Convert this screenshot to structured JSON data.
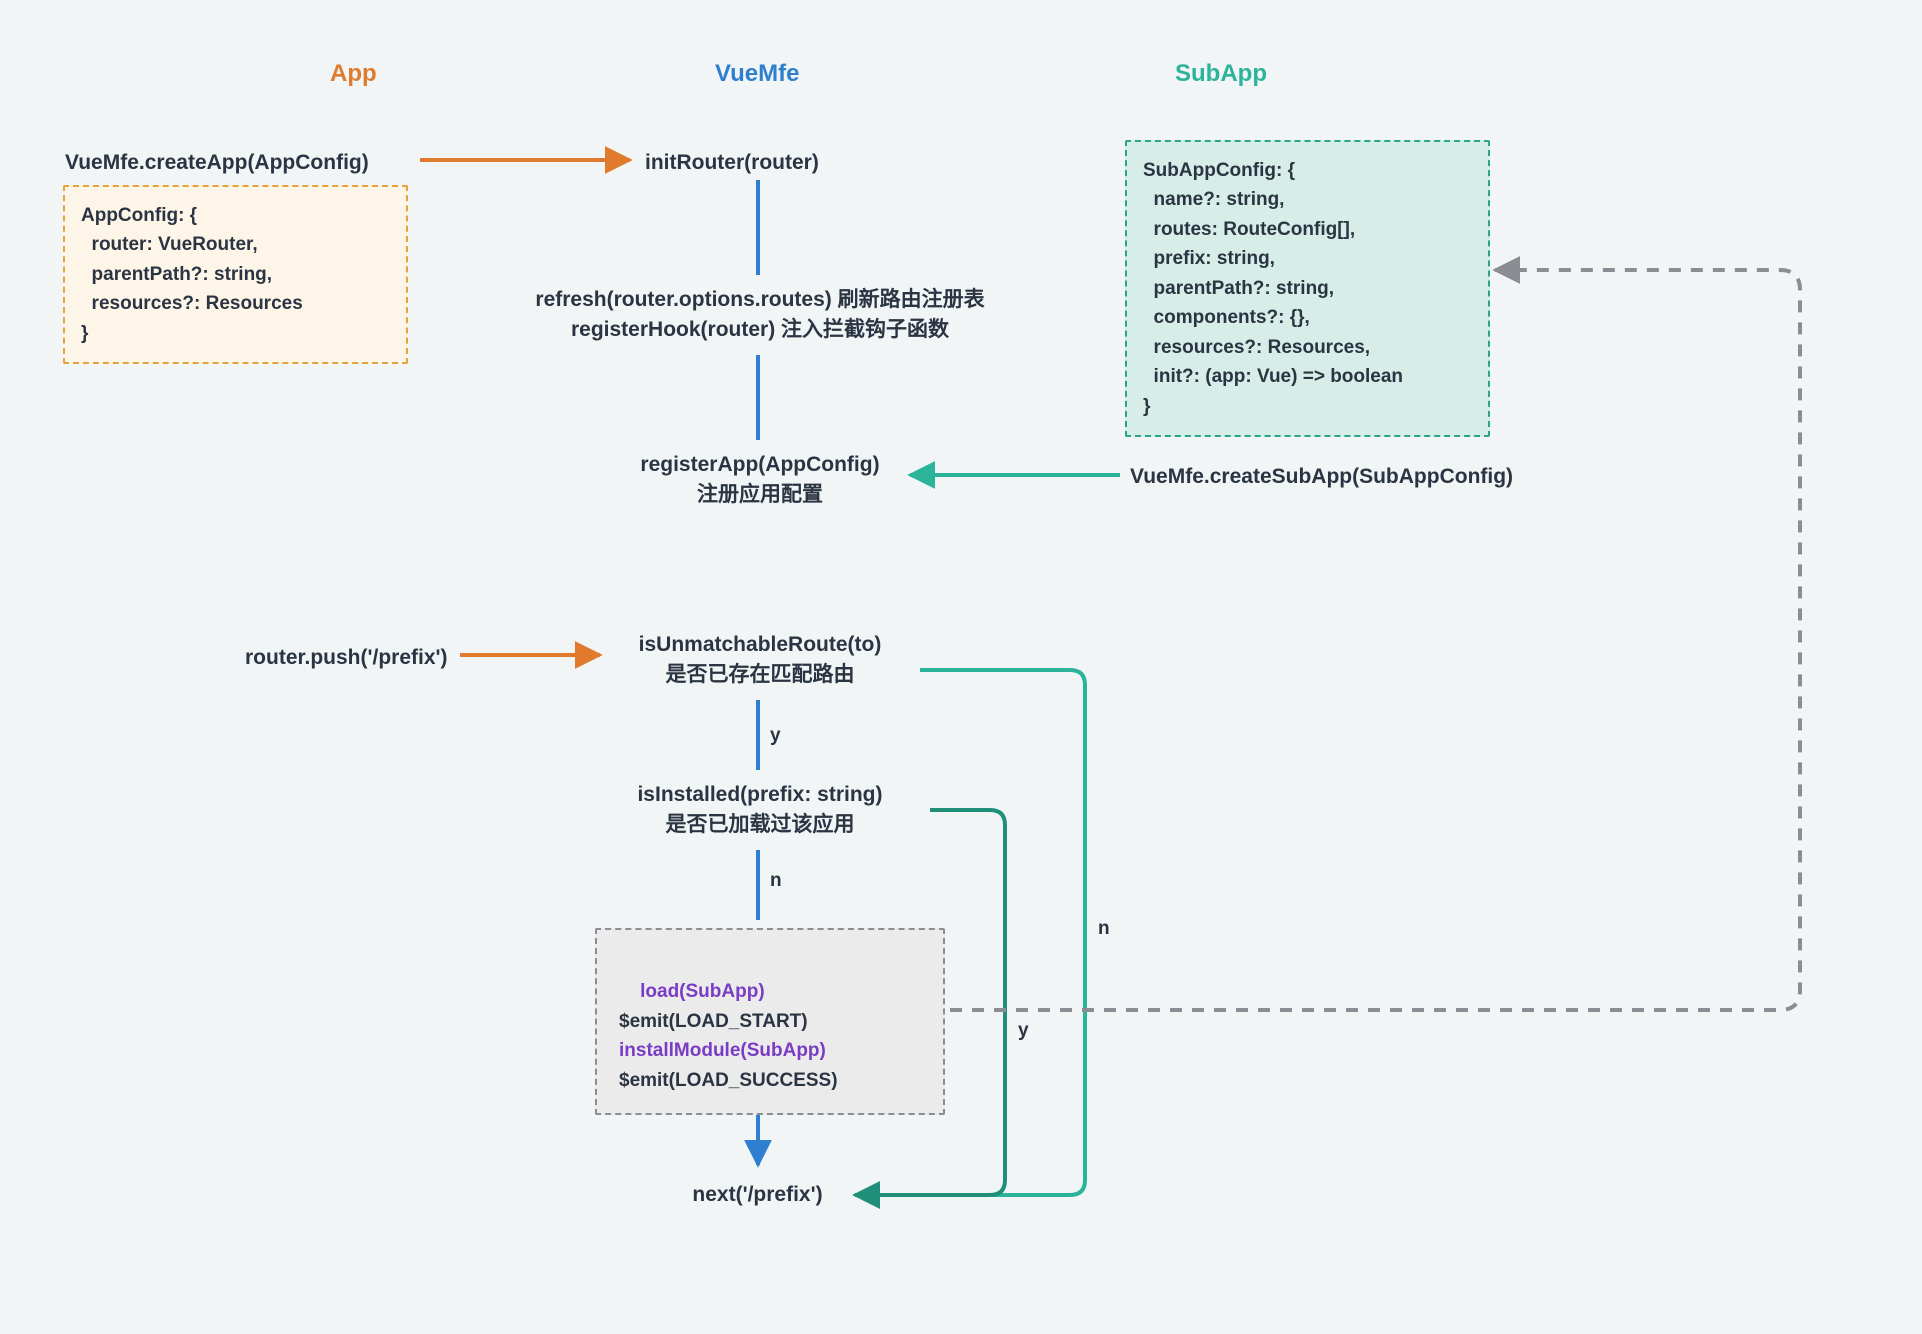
{
  "headers": {
    "app": "App",
    "vuemfe": "VueMfe",
    "subapp": "SubApp"
  },
  "colors": {
    "orange": "#e07b2e",
    "blue": "#2f7fd1",
    "teal": "#2bb49a",
    "tealDark": "#1f8f7a",
    "gray": "#8a8d93",
    "purple": "#7a3cc4",
    "text": "#2b3442"
  },
  "nodes": {
    "createApp": "VueMfe.createApp(AppConfig)",
    "appConfig": "AppConfig: {\n  router: VueRouter,\n  parentPath?: string,\n  resources?: Resources\n}",
    "initRouter": "initRouter(router)",
    "refreshRegister_l1": "refresh(router.options.routes) 刷新路由注册表",
    "refreshRegister_l2": "registerHook(router) 注入拦截钩子函数",
    "registerApp_l1": "registerApp(AppConfig)",
    "registerApp_l2": "注册应用配置",
    "subAppConfig": "SubAppConfig: {\n  name?: string,\n  routes: RouteConfig[],\n  prefix: string,\n  parentPath?: string,\n  components?: {},\n  resources?: Resources,\n  init?: (app: Vue) => boolean\n}",
    "createSubApp": "VueMfe.createSubApp(SubAppConfig)",
    "routerPush": "router.push('/prefix')",
    "isUnmatch_l1": "isUnmatchableRoute(to)",
    "isUnmatch_l2": "是否已存在匹配路由",
    "isInstalled_l1": "isInstalled(prefix: string)",
    "isInstalled_l2": "是否已加载过该应用",
    "load_l1": "load(SubApp)",
    "load_l2": "$emit(LOAD_START)",
    "load_l3": "installModule(SubApp)",
    "load_l4": "$emit(LOAD_SUCCESS)",
    "next": "next('/prefix')"
  },
  "edgeLabels": {
    "y1": "y",
    "n1": "n",
    "y2": "y",
    "n2": "n"
  }
}
